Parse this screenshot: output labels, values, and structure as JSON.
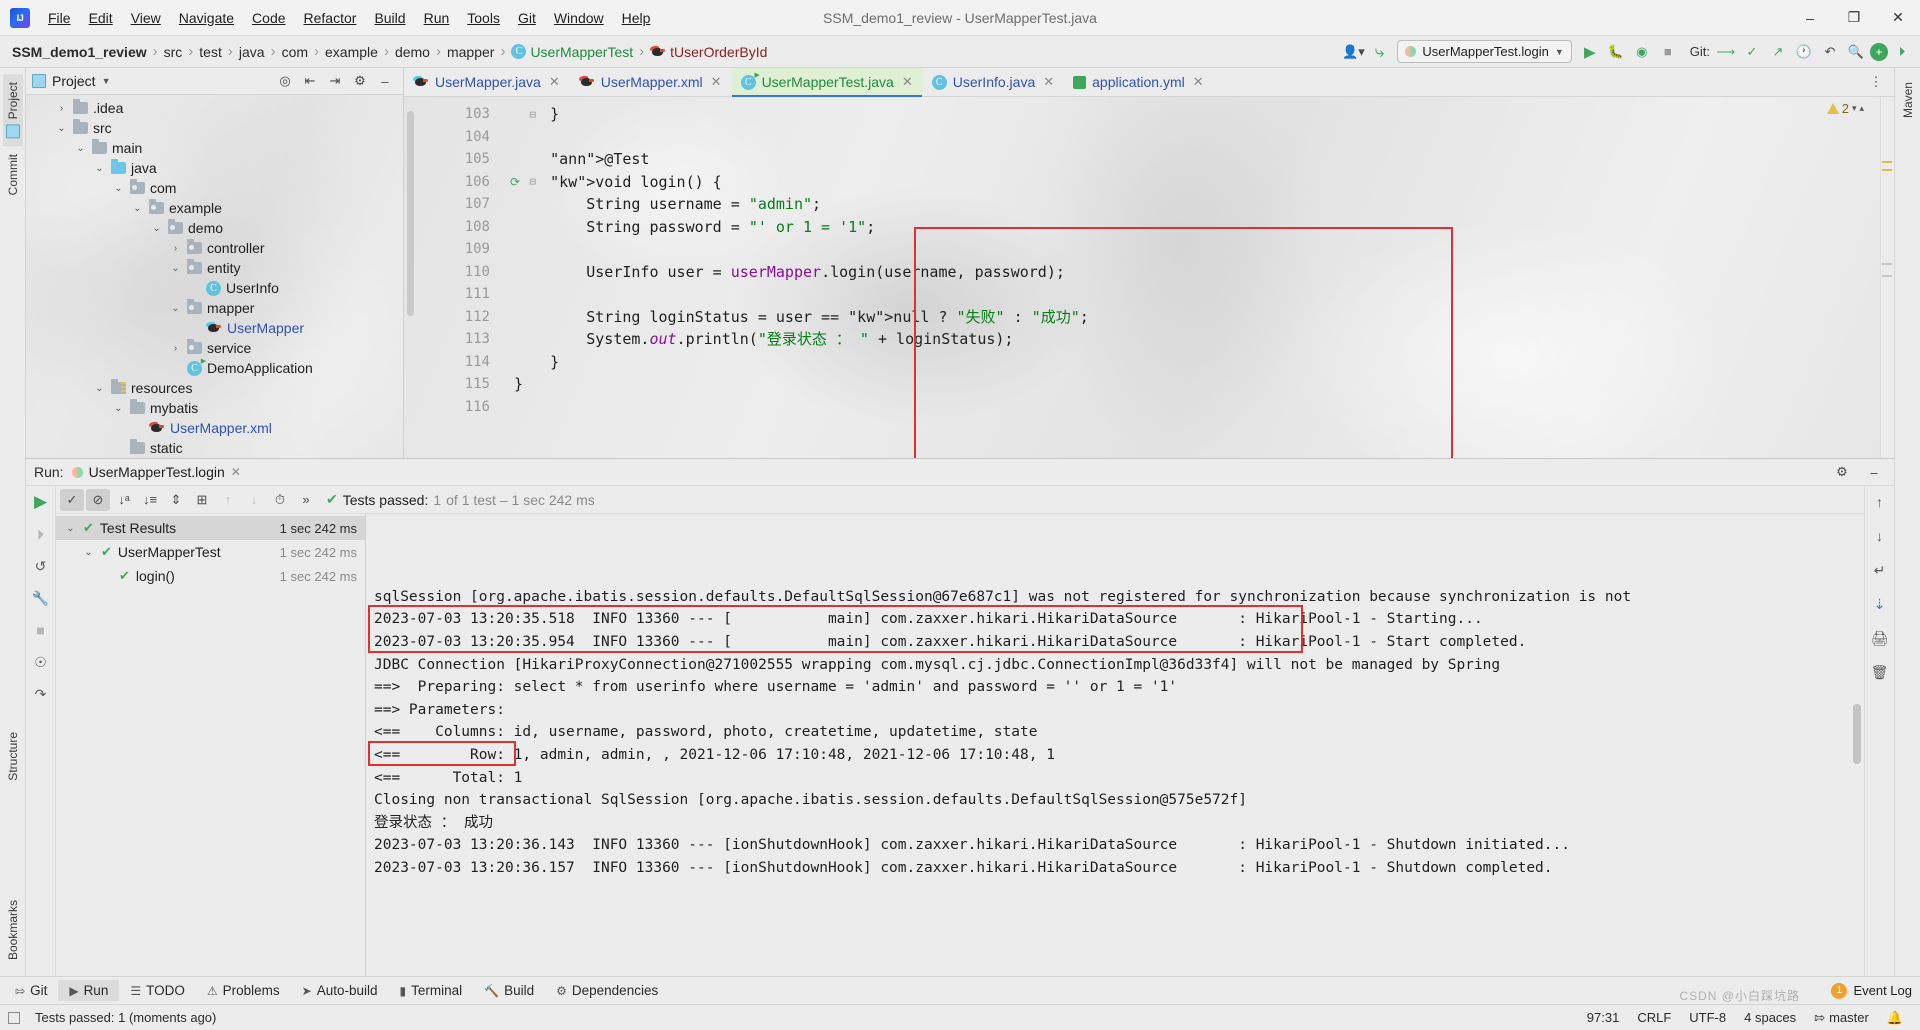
{
  "window": {
    "title": "SSM_demo1_review - UserMapperTest.java",
    "minimize": "–",
    "maximize": "❐",
    "close": "✕"
  },
  "menu": [
    "File",
    "Edit",
    "View",
    "Navigate",
    "Code",
    "Refactor",
    "Build",
    "Run",
    "Tools",
    "Git",
    "Window",
    "Help"
  ],
  "breadcrumbs": [
    {
      "label": "SSM_demo1_review",
      "style": "bold"
    },
    {
      "label": "src",
      "style": "plain"
    },
    {
      "label": "test",
      "style": "plain"
    },
    {
      "label": "java",
      "style": "plain"
    },
    {
      "label": "com",
      "style": "plain"
    },
    {
      "label": "example",
      "style": "plain"
    },
    {
      "label": "demo",
      "style": "plain"
    },
    {
      "label": "mapper",
      "style": "plain"
    },
    {
      "label": "UserMapperTest",
      "style": "green"
    },
    {
      "label": "tUserOrderById",
      "style": "maroon"
    }
  ],
  "toolbar": {
    "run_config": "UserMapperTest.login",
    "git_label": "Git:",
    "search_icon": "search-icon",
    "settings_icon": "gear-icon"
  },
  "project_panel": {
    "tab_label": "Project",
    "tree": [
      {
        "depth": 1,
        "label": ".idea",
        "arrow": "›",
        "icon": "folder",
        "color": "dark"
      },
      {
        "depth": 1,
        "label": "src",
        "arrow": "⌄",
        "icon": "folder",
        "color": "dark"
      },
      {
        "depth": 2,
        "label": "main",
        "arrow": "⌄",
        "icon": "folder",
        "color": "dark"
      },
      {
        "depth": 3,
        "label": "java",
        "arrow": "⌄",
        "icon": "folder-blue",
        "color": "dark"
      },
      {
        "depth": 4,
        "label": "com",
        "arrow": "⌄",
        "icon": "folder-pkg",
        "color": "dark"
      },
      {
        "depth": 5,
        "label": "example",
        "arrow": "⌄",
        "icon": "folder-pkg",
        "color": "dark"
      },
      {
        "depth": 6,
        "label": "demo",
        "arrow": "⌄",
        "icon": "folder-pkg",
        "color": "dark"
      },
      {
        "depth": 7,
        "label": "controller",
        "arrow": "›",
        "icon": "folder-pkg",
        "color": "dark"
      },
      {
        "depth": 7,
        "label": "entity",
        "arrow": "⌄",
        "icon": "folder-pkg",
        "color": "dark"
      },
      {
        "depth": 8,
        "label": "UserInfo",
        "arrow": "",
        "icon": "class",
        "color": "dark"
      },
      {
        "depth": 7,
        "label": "mapper",
        "arrow": "⌄",
        "icon": "folder-pkg",
        "color": "dark"
      },
      {
        "depth": 8,
        "label": "UserMapper",
        "arrow": "",
        "icon": "mybatis",
        "color": "blue"
      },
      {
        "depth": 7,
        "label": "service",
        "arrow": "›",
        "icon": "folder-pkg",
        "color": "dark"
      },
      {
        "depth": 7,
        "label": "DemoApplication",
        "arrow": "",
        "icon": "class-run",
        "color": "dark"
      },
      {
        "depth": 3,
        "label": "resources",
        "arrow": "⌄",
        "icon": "folder-res",
        "color": "dark"
      },
      {
        "depth": 4,
        "label": "mybatis",
        "arrow": "⌄",
        "icon": "folder",
        "color": "dark"
      },
      {
        "depth": 5,
        "label": "UserMapper.xml",
        "arrow": "",
        "icon": "mybatis-red",
        "color": "blue"
      },
      {
        "depth": 4,
        "label": "static",
        "arrow": "",
        "icon": "folder",
        "color": "dark"
      }
    ]
  },
  "editor": {
    "tabs": [
      {
        "label": "UserMapper.java",
        "icon": "mybatis-icon",
        "active": false
      },
      {
        "label": "UserMapper.xml",
        "icon": "mybatis-red-icon",
        "active": false
      },
      {
        "label": "UserMapperTest.java",
        "icon": "class-run-icon",
        "active": true
      },
      {
        "label": "UserInfo.java",
        "icon": "class-icon",
        "active": false
      },
      {
        "label": "application.yml",
        "icon": "yml-icon",
        "active": false
      }
    ],
    "warning_count": "2",
    "line_numbers": [
      "103",
      "104",
      "105",
      "106",
      "107",
      "108",
      "109",
      "110",
      "111",
      "112",
      "113",
      "114",
      "115",
      "116"
    ],
    "code_lines": [
      "    }",
      "",
      "    @Test",
      "    void login() {",
      "        String username = \"admin\";",
      "        String password = \"' or 1 = '1\";",
      "",
      "        UserInfo user = userMapper.login(username, password);",
      "",
      "        String loginStatus = user == null ? \"失败\" : \"成功\";",
      "        System.out.println(\"登录状态 ： \" + loginStatus);",
      "    }",
      "}",
      ""
    ]
  },
  "run_panel": {
    "run_label": "Run:",
    "run_tab": "UserMapperTest.login",
    "tests_status_prefix": "Tests passed:",
    "tests_status_count": "1",
    "tests_status_suffix": "of 1 test – 1 sec 242 ms",
    "test_tree": [
      {
        "depth": 0,
        "label": "Test Results",
        "time": "1 sec 242 ms",
        "arrow": "⌄",
        "selected": true
      },
      {
        "depth": 1,
        "label": "UserMapperTest",
        "time": "1 sec 242 ms",
        "arrow": "⌄",
        "selected": false
      },
      {
        "depth": 2,
        "label": "login()",
        "time": "1 sec 242 ms",
        "arrow": "",
        "selected": false
      }
    ],
    "console_lines": [
      "sqlSession [org.apache.ibatis.session.defaults.DefaultSqlSession@67e687c1] was not registered for synchronization because synchronization is not",
      "2023-07-03 13:20:35.518  INFO 13360 --- [           main] com.zaxxer.hikari.HikariDataSource       : HikariPool-1 - Starting...",
      "2023-07-03 13:20:35.954  INFO 13360 --- [           main] com.zaxxer.hikari.HikariDataSource       : HikariPool-1 - Start completed.",
      "JDBC Connection [HikariProxyConnection@271002555 wrapping com.mysql.cj.jdbc.ConnectionImpl@36d33f4] will not be managed by Spring",
      "==>  Preparing: select * from userinfo where username = 'admin' and password = '' or 1 = '1'",
      "==> Parameters:",
      "<==    Columns: id, username, password, photo, createtime, updatetime, state",
      "<==        Row: 1, admin, admin, , 2021-12-06 17:10:48, 2021-12-06 17:10:48, 1",
      "<==      Total: 1",
      "Closing non transactional SqlSession [org.apache.ibatis.session.defaults.DefaultSqlSession@575e572f]",
      "登录状态 ： 成功",
      "2023-07-03 13:20:36.143  INFO 13360 --- [ionShutdownHook] com.zaxxer.hikari.HikariDataSource       : HikariPool-1 - Shutdown initiated...",
      "2023-07-03 13:20:36.157  INFO 13360 --- [ionShutdownHook] com.zaxxer.hikari.HikariDataSource       : HikariPool-1 - Shutdown completed."
    ]
  },
  "left_strip": {
    "tabs": [
      "Project",
      "Commit",
      "Structure",
      "Bookmarks"
    ]
  },
  "right_strip": {
    "tabs": [
      "Maven"
    ]
  },
  "tool_window_bar": {
    "items": [
      {
        "label": "Git",
        "icon": "git-icon",
        "active": false
      },
      {
        "label": "Run",
        "icon": "play-icon",
        "active": true
      },
      {
        "label": "TODO",
        "icon": "list-icon",
        "active": false
      },
      {
        "label": "Problems",
        "icon": "warning-icon",
        "active": false
      },
      {
        "label": "Auto-build",
        "icon": "triangle-icon",
        "active": false
      },
      {
        "label": "Terminal",
        "icon": "terminal-icon",
        "active": false
      },
      {
        "label": "Build",
        "icon": "hammer-icon",
        "active": false
      },
      {
        "label": "Dependencies",
        "icon": "dependencies-icon",
        "active": false
      }
    ],
    "event_log": "Event Log",
    "event_count": "1"
  },
  "status_bar": {
    "message": "Tests passed: 1 (moments ago)",
    "caret": "97:31",
    "line_sep": "CRLF",
    "encoding": "UTF-8",
    "indent": "4 spaces",
    "branch": "master"
  },
  "watermark": "CSDN @小白踩坑路"
}
